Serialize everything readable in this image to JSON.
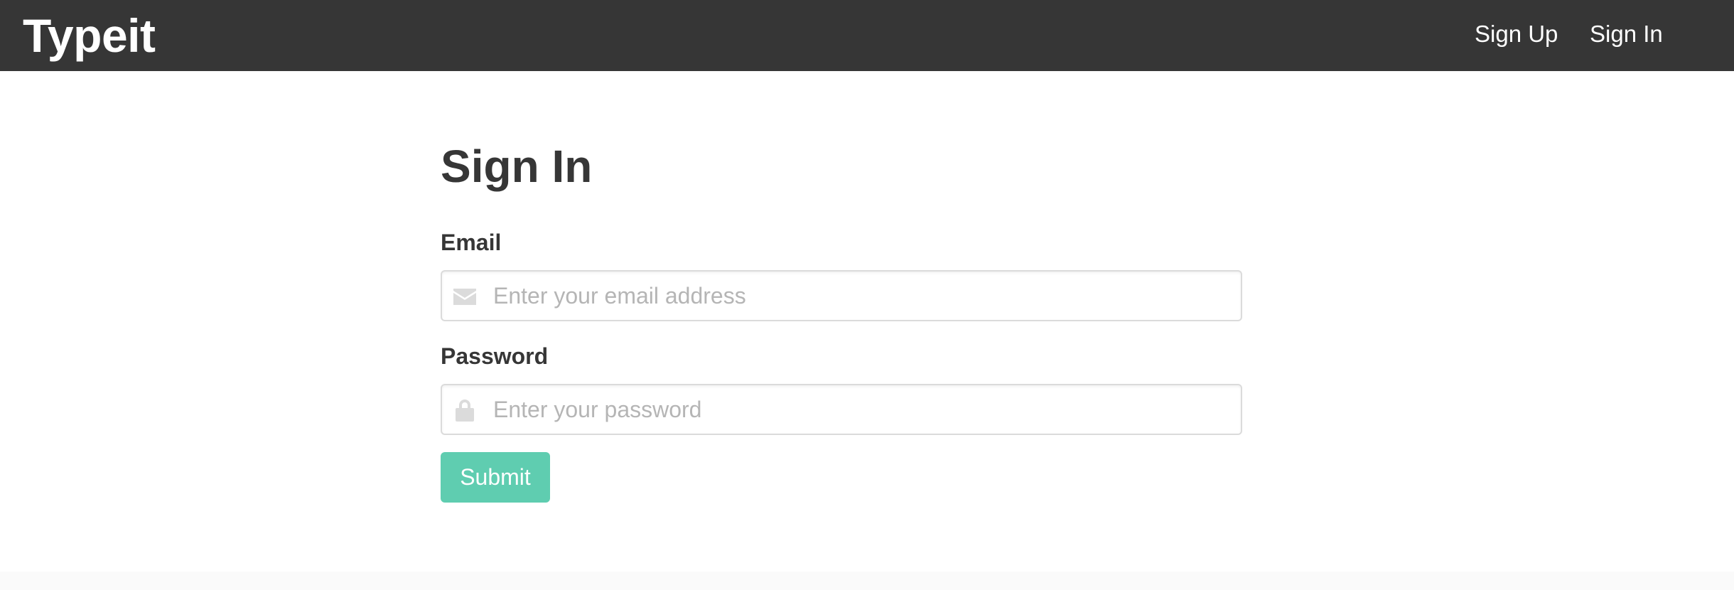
{
  "navbar": {
    "brand": "Typeit",
    "links": [
      {
        "label": "Sign Up"
      },
      {
        "label": "Sign In"
      }
    ]
  },
  "form": {
    "title": "Sign In",
    "email": {
      "label": "Email",
      "placeholder": "Enter your email address",
      "value": "",
      "icon": "envelope-icon"
    },
    "password": {
      "label": "Password",
      "placeholder": "Enter your password",
      "value": "",
      "icon": "lock-icon"
    },
    "submit_label": "Submit"
  },
  "colors": {
    "navbar_bg": "#363636",
    "text_dark": "#363636",
    "primary_button": "#5fcdb0",
    "input_border": "#dbdbdb",
    "placeholder": "#b5b5b5",
    "icon_gray": "#dbdbdb",
    "footer_bg": "#fafafa"
  }
}
